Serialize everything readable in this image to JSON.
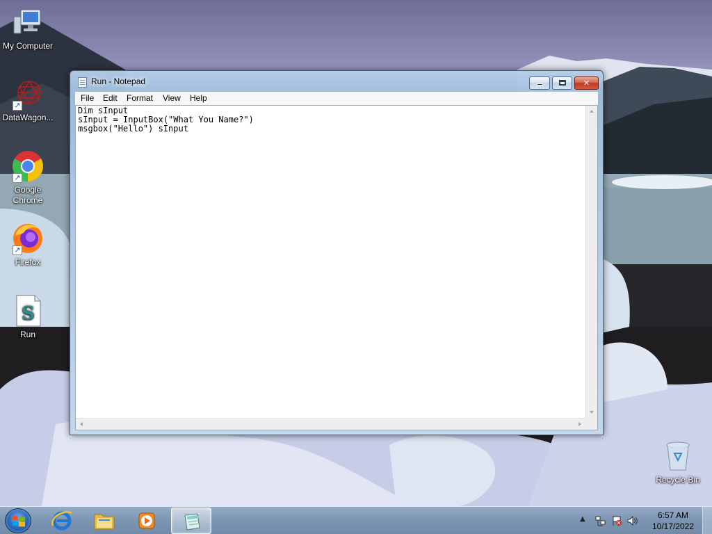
{
  "desktop": {
    "icons": [
      {
        "label": "My Computer",
        "icon": "computer-icon"
      },
      {
        "label": "DataWagon...",
        "icon": "datawagon-icon"
      },
      {
        "label": "Google Chrome",
        "icon": "chrome-icon"
      },
      {
        "label": "Firefox",
        "icon": "firefox-icon"
      },
      {
        "label": "Run",
        "icon": "script-file-icon"
      },
      {
        "label": "Recycle Bin",
        "icon": "recycle-bin-icon"
      }
    ]
  },
  "window": {
    "title": "Run - Notepad",
    "menu": [
      "File",
      "Edit",
      "Format",
      "View",
      "Help"
    ],
    "content": "Dim sInput\nsInput = InputBox(\"What You Name?\")\nmsgbox(\"Hello\") sInput",
    "buttons": {
      "minimize": "minimize",
      "maximize": "maximize",
      "close": "✕"
    }
  },
  "taskbar": {
    "apps": [
      {
        "name": "internet-explorer",
        "icon": "ie-icon"
      },
      {
        "name": "windows-explorer",
        "icon": "folder-icon"
      },
      {
        "name": "media-player",
        "icon": "media-player-icon"
      },
      {
        "name": "notepad",
        "icon": "notepad-icon",
        "active": true
      }
    ],
    "clock": {
      "time": "6:57 AM",
      "date": "10/17/2022"
    }
  }
}
